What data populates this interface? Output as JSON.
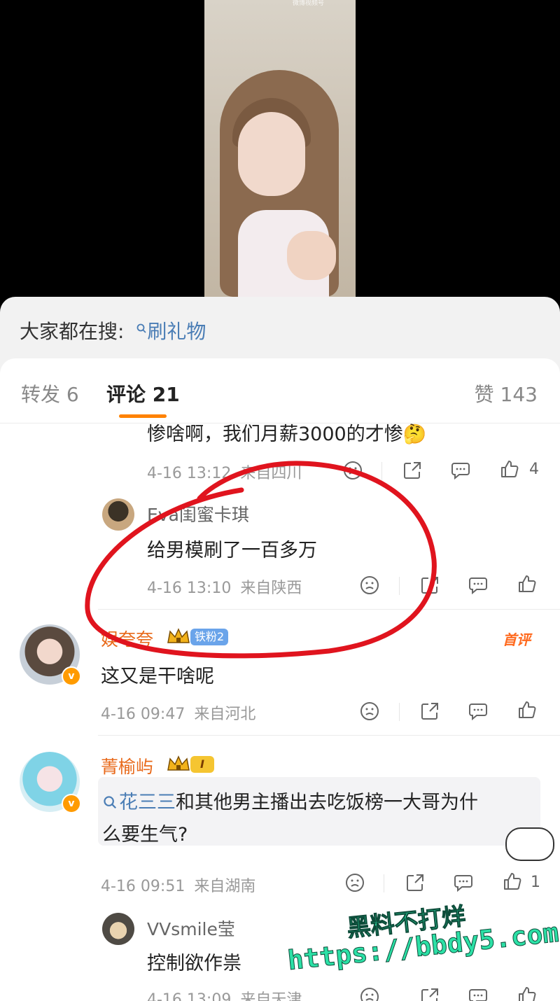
{
  "video": {
    "watermark": "微博视频号"
  },
  "search": {
    "prefix": "大家都在搜:",
    "term": "刷礼物"
  },
  "tabs": {
    "repost": "转发 6",
    "comments": "评论 21",
    "likes": "赞 143"
  },
  "comments": [
    {
      "text": "惨啥啊，我们月薪3000的才惨",
      "emoji": "🤔",
      "date": "4-16 13:12",
      "location": "来自四川",
      "likes": "4"
    },
    {
      "author": "Eva闺蜜卡琪",
      "text": "给男模刷了一百多万",
      "date": "4-16 13:10",
      "location": "来自陕西",
      "likes": ""
    },
    {
      "author": "娱夸夸",
      "badge": "铁粉2",
      "first_label": "首评",
      "text": "这又是干啥呢",
      "date": "4-16 09:47",
      "location": "来自河北",
      "likes": ""
    },
    {
      "author": "菁榆屿",
      "badge": "I",
      "mention": "花三三",
      "text_line1": "和其他男主播出去吃饭榜一大哥为什",
      "text_line2": "么要生气?",
      "date": "4-16 09:51",
      "location": "来自湖南",
      "likes": "1"
    },
    {
      "author": "VVsmile莹",
      "text": "控制欲作祟",
      "date": "4-16 13:09",
      "location": "来自天津",
      "likes": ""
    }
  ],
  "watermark": {
    "line1": "黑料不打烊",
    "line2": "https://bbdy5.com"
  },
  "colors": {
    "accent": "#ff8200",
    "link": "#4a7db5",
    "username_orange": "#e8691a",
    "annotation_red": "#e0141e",
    "watermark_green": "#2ce0a6"
  }
}
